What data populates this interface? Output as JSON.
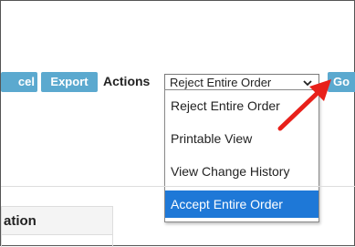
{
  "toolbar": {
    "cancel_label": "cel",
    "export_label": "Export",
    "actions_label": "Actions",
    "select_value": "Reject Entire Order",
    "go_label": "Go"
  },
  "dropdown": {
    "items": [
      {
        "label": "Reject Entire Order"
      },
      {
        "label": "Printable View"
      },
      {
        "label": "View Change History"
      },
      {
        "label": "Accept Entire Order",
        "selected": true
      }
    ]
  },
  "table": {
    "header_label": "ation"
  },
  "annotation": {
    "arrow_color": "#e8201a",
    "arrow_icon": "red-arrow-icon"
  },
  "colors": {
    "button_bg": "#5ba9cf",
    "selected_bg": "#1e78d7"
  }
}
